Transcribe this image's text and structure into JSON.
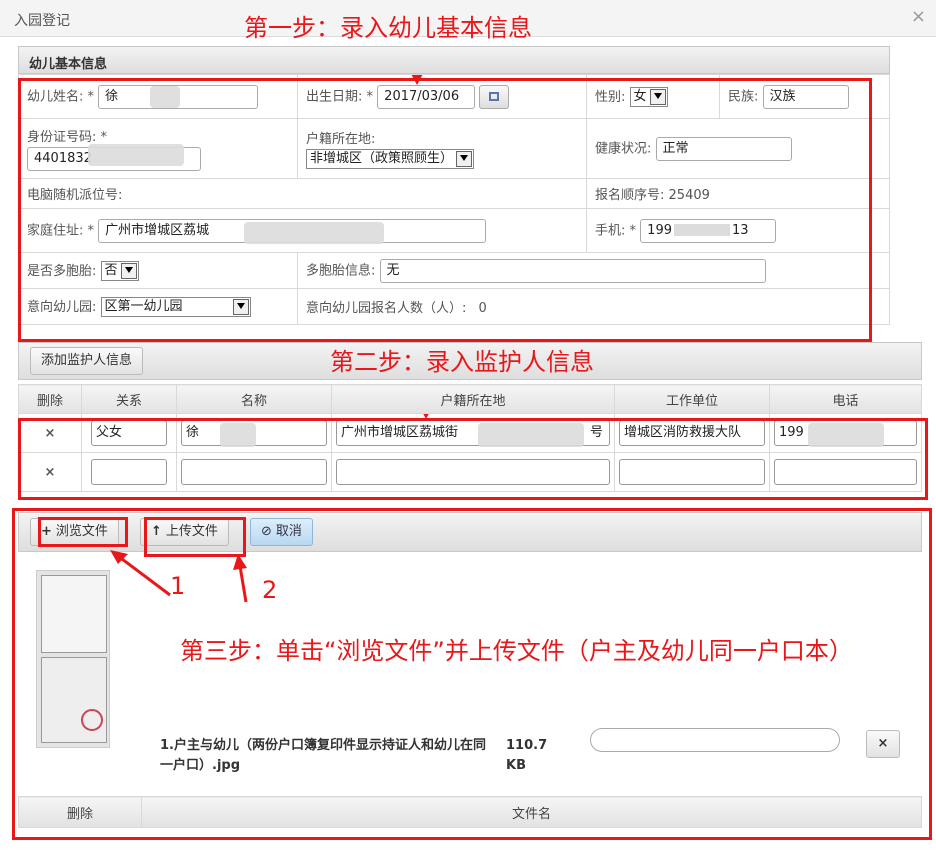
{
  "window": {
    "title": "入园登记",
    "close_glyph": "×"
  },
  "annotations": {
    "step1": "第一步：录入幼儿基本信息",
    "step2": "第二步：录入监护人信息",
    "step3": "第三步：单击“浏览文件”并上传文件（户主及幼儿同一户口本）",
    "marker1": "1",
    "marker2": "2",
    "color": "#e8171a"
  },
  "basic": {
    "header": "幼儿基本信息",
    "name_label": "幼儿姓名:",
    "name_value": "徐",
    "birth_label": "出生日期:",
    "birth_value": "2017/03/06",
    "gender_label": "性别:",
    "gender_value": "女",
    "ethnic_label": "民族:",
    "ethnic_value": "汉族",
    "id_label": "身份证号码:",
    "id_value": "4401832",
    "huji_label": "户籍所在地:",
    "huji_value": "非增城区（政策照顾生）",
    "health_label": "健康状况:",
    "health_value": "正常",
    "computer_label": "电脑随机派位号:",
    "seq_label": "报名顺序号:",
    "seq_value": "25409",
    "addr_label": "家庭住址:",
    "addr_value": "广州市增城区荔城",
    "phone_label": "手机:",
    "phone_value_a": "199",
    "phone_value_b": "13",
    "multi_label": "是否多胞胎:",
    "multi_value": "否",
    "multi_info_label": "多胞胎信息:",
    "multi_info_value": "无",
    "kinder_label": "意向幼儿园:",
    "kinder_value": "区第一幼儿园",
    "kinder_count_label": "意向幼儿园报名人数（人）:",
    "kinder_count_value": "0",
    "required_mark": "*"
  },
  "guardian": {
    "add_button": "添加监护人信息",
    "columns": [
      "删除",
      "关系",
      "名称",
      "户籍所在地",
      "工作单位",
      "电话"
    ],
    "rows": [
      {
        "del": "×",
        "relation": "父女",
        "name": "徐",
        "huji": "广州市增城区荔城街",
        "huji_end": "号",
        "work": "增城区消防救援大队",
        "phone": "199"
      },
      {
        "del": "×",
        "relation": "",
        "name": "",
        "huji": "",
        "huji_end": "",
        "work": "",
        "phone": ""
      }
    ]
  },
  "upload": {
    "browse": "浏览文件",
    "upload": "上传文件",
    "cancel": "取消",
    "file_name": "1.户主与幼儿（两份户口簿复印件显示持证人和幼儿在同一户口）.jpg",
    "file_size": "110.7 KB",
    "remove": "×",
    "col_delete": "删除",
    "col_filename": "文件名"
  }
}
